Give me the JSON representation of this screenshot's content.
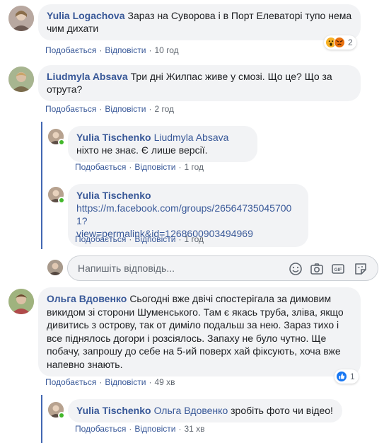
{
  "actions": {
    "like": "Подобається",
    "reply": "Відповісти"
  },
  "comments": [
    {
      "author": "Yulia Logachova",
      "text": "Зараз на Суворова і в Порт Елеваторі тупо нема чим дихати",
      "time": "10 год",
      "reactions": {
        "icons": [
          "wow-icon",
          "angry-icon"
        ],
        "count": "2"
      }
    },
    {
      "author": "Liudmyla Absava",
      "text": "Три дні Жилпас живе у смозі. Що це? Що за отрута?",
      "time": "2 год",
      "replies": [
        {
          "author": "Yulia Tischenko",
          "mention": "Liudmyla Absava",
          "text": "ніхто не знає. Є лише версії.",
          "time": "1 год"
        },
        {
          "author": "Yulia Tischenko",
          "link": "https://m.facebook.com/groups/265647350457001?view=permalink&id=1268600903494969",
          "link_line1": "https://m.facebook.com/groups/265647350457001?",
          "link_line2": "view=permalink&id=1268600903494969",
          "time": "1 год"
        }
      ]
    },
    {
      "author": "Ольга Вдовенко",
      "text": "Сьогодні вже двічі спостерігала за димовим викидом зі сторони Шуменського. Там є якась труба, зліва, якщо дивитись з острову, так от диміло подальш за нею. Зараз тихо і все піднялось догори і розсіялось. Запаху не було чутно. Ще побачу, запрошу до себе на 5-ий поверх хай фіксують, хоча вже напевно знають.",
      "time": "49 хв",
      "reactions": {
        "icons": [
          "like-icon"
        ],
        "count": "1"
      },
      "replies": [
        {
          "author": "Yulia Tischenko",
          "mention": "Ольга Вдовенко",
          "text": "зробіть фото чи відео!",
          "time": "31 хв"
        }
      ]
    }
  ],
  "reply_box": {
    "placeholder": "Напишіть відповідь...",
    "tools": [
      "emoji-icon",
      "camera-icon",
      "gif-icon",
      "sticker-icon"
    ]
  },
  "colors": {
    "link": "#385898",
    "bubble": "#f2f3f5",
    "thread_line": "#4267b2",
    "online": "#42b72a"
  }
}
